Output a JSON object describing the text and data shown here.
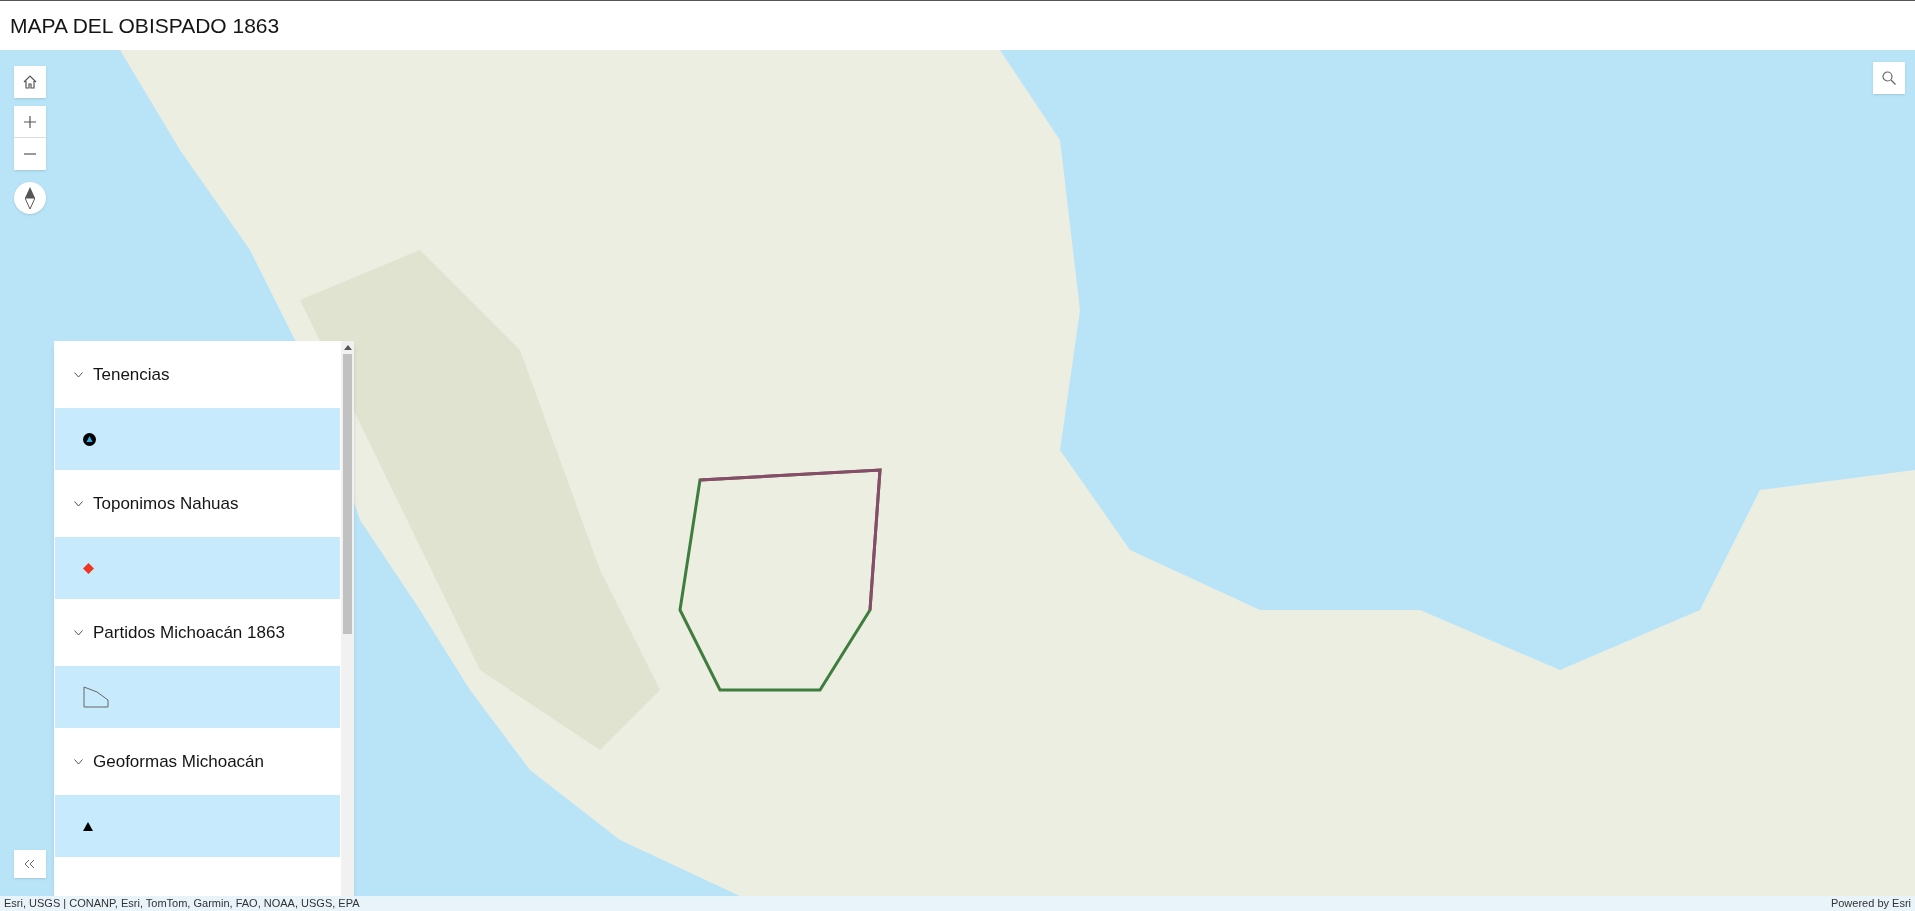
{
  "header": {
    "title": "MAPA DEL OBISPADO 1863"
  },
  "legend": {
    "layers": [
      {
        "title": "Tenencias",
        "expanded": true,
        "kind": "marker"
      },
      {
        "title": "Toponimos Nahuas",
        "expanded": true,
        "kind": "diamond"
      },
      {
        "title": "Partidos Michoacán 1863",
        "expanded": true,
        "kind": "polygon"
      },
      {
        "title": "Geoformas Michoacán",
        "expanded": true,
        "kind": "triangle"
      }
    ]
  },
  "attribution": {
    "sources": "Esri, USGS | CONANP, Esri, TomTom, Garmin, FAO, NOAA, USGS, EPA",
    "powered_by": "Powered by Esri"
  }
}
